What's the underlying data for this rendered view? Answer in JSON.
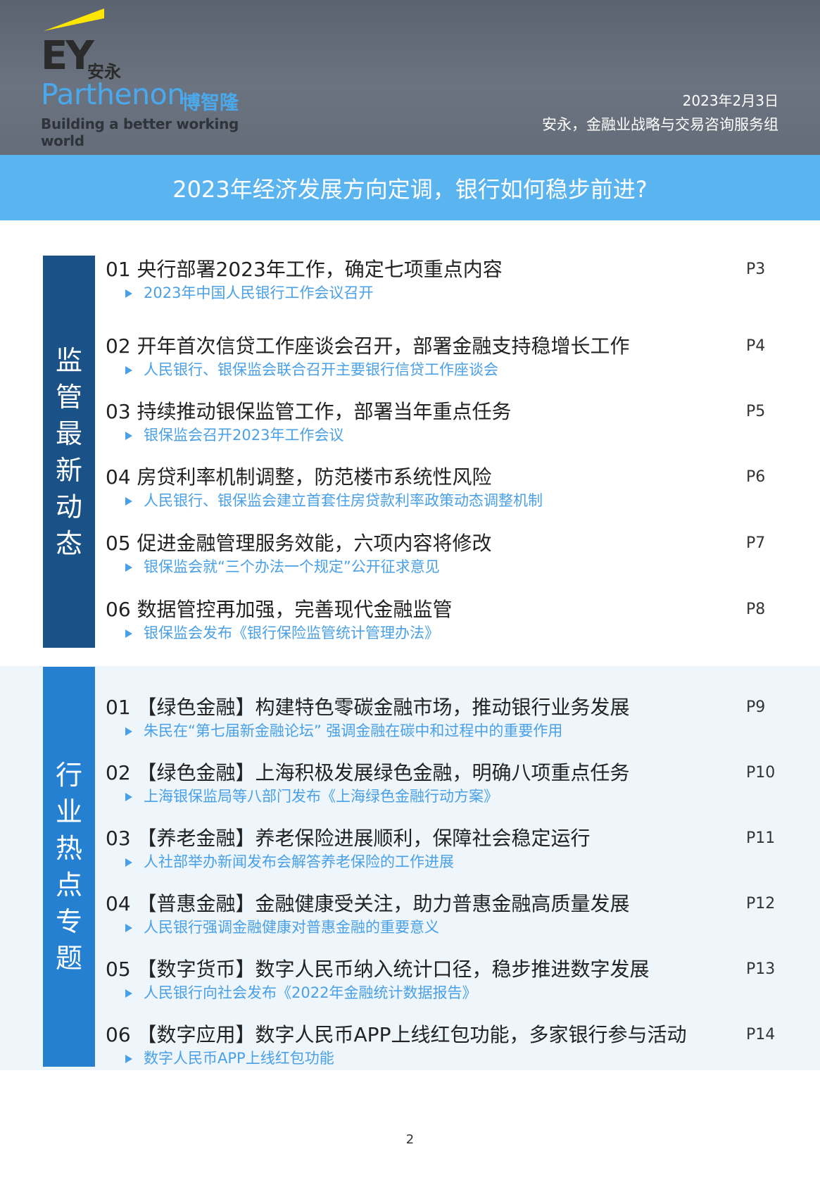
{
  "header": {
    "logo": {
      "ey": "EY",
      "ey_cn": "安永",
      "brand": "Parthenon",
      "brand_cn": "博智隆",
      "slogan": "Building a better working world"
    },
    "date": "2023年2月3日",
    "org": "安永，金融业战略与交易咨询服务组"
  },
  "banner": {
    "title": "2023年经济发展方向定调，银行如何稳步前进?"
  },
  "sections": [
    {
      "label": "监管最新动态",
      "label_chars": [
        "监",
        "管",
        "最",
        "新",
        "动",
        "态"
      ],
      "items": [
        {
          "title": "01 央行部署2023年工作，确定七项重点内容",
          "sub": "2023年中国人民银行工作会议召开",
          "page": "P3"
        },
        {
          "title": "02 开年首次信贷工作座谈会召开，部署金融支持稳增长工作",
          "sub": "人民银行、银保监会联合召开主要银行信贷工作座谈会",
          "page": "P4"
        },
        {
          "title": "03 持续推动银保监管工作，部署当年重点任务",
          "sub": "银保监会召开2023年工作会议",
          "page": "P5"
        },
        {
          "title": "04 房贷利率机制调整，防范楼市系统性风险",
          "sub": "人民银行、银保监会建立首套住房贷款利率政策动态调整机制",
          "page": "P6"
        },
        {
          "title": "05 促进金融管理服务效能，六项内容将修改",
          "sub": "银保监会就“三个办法一个规定”公开征求意见",
          "page": "P7"
        },
        {
          "title": "06 数据管控再加强，完善现代金融监管",
          "sub": "银保监会发布《银行保险监管统计管理办法》",
          "page": "P8"
        }
      ]
    },
    {
      "label": "行业热点专题",
      "label_chars": [
        "行",
        "业",
        "热",
        "点",
        "专",
        "题"
      ],
      "items": [
        {
          "title": "01 【绿色金融】构建特色零碳金融市场，推动银行业务发展",
          "sub": "朱民在“第七届新金融论坛” 强调金融在碳中和过程中的重要作用",
          "page": "P9"
        },
        {
          "title": "02 【绿色金融】上海积极发展绿色金融，明确八项重点任务",
          "sub": "上海银保监局等八部门发布《上海绿色金融行动方案》",
          "page": "P10"
        },
        {
          "title": "03 【养老金融】养老保险进展顺利，保障社会稳定运行",
          "sub": "人社部举办新闻发布会解答养老保险的工作进展",
          "page": "P11"
        },
        {
          "title": "04 【普惠金融】金融健康受关注，助力普惠金融高质量发展",
          "sub": "人民银行强调金融健康对普惠金融的重要意义",
          "page": "P12"
        },
        {
          "title": "05 【数字货币】数字人民币纳入统计口径，稳步推进数字发展",
          "sub": "人民银行向社会发布《2022年金融统计数据报告》",
          "page": "P13"
        },
        {
          "title": "06 【数字应用】数字人民币APP上线红包功能，多家银行参与活动",
          "sub": "数字人民币APP上线红包功能",
          "page": "P14"
        }
      ]
    }
  ],
  "footer": {
    "page_number": "2"
  },
  "colors": {
    "header_bg": "#656d7a",
    "banner_bg": "#5ab4f0",
    "section1_bar": "#1a5287",
    "section2_bar": "#2580d2",
    "section2_bg": "#eef6fc",
    "link_blue": "#4aa0e6",
    "ey_yellow": "#ffe600"
  }
}
